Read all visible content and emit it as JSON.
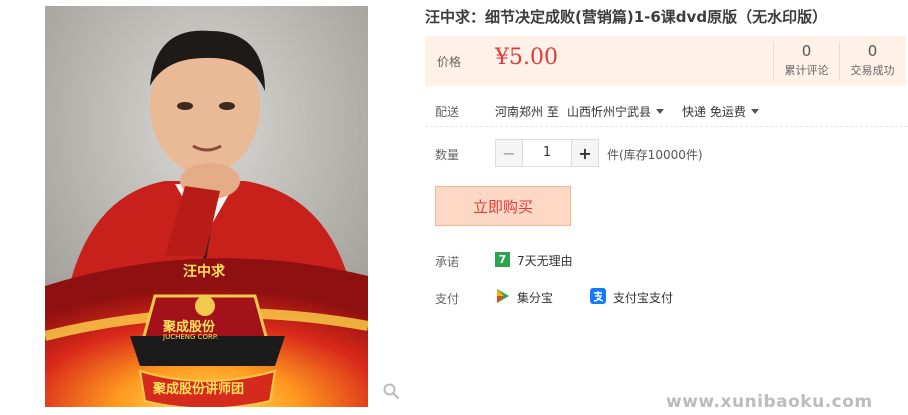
{
  "product": {
    "title": "汪中求：细节决定成败(营销篇)1-6课dvd原版（无水印版）",
    "image": {
      "person_caption": "汪中求",
      "logo_text": "聚成股份",
      "logo_subtext": "JUCHENG CORP.",
      "ribbon_text": "聚成股份讲师团"
    }
  },
  "price": {
    "label": "价格",
    "value": "¥5.00",
    "stats": [
      {
        "num": "0",
        "label": "累计评论"
      },
      {
        "num": "0",
        "label": "交易成功"
      }
    ]
  },
  "shipping": {
    "label": "配送",
    "from": "河南郑州 至",
    "to": "山西忻州宁武县",
    "method": "快递 免运费"
  },
  "quantity": {
    "label": "数量",
    "minus": "−",
    "value": "1",
    "plus": "+",
    "stock": "件(库存10000件)"
  },
  "buy_button": "立即购买",
  "promise": {
    "label": "承诺",
    "icon_text": "7",
    "text": "7天无理由"
  },
  "payment": {
    "label": "支付",
    "methods": [
      {
        "icon": "jifenbao-icon",
        "label": "集分宝"
      },
      {
        "icon": "alipay-icon",
        "label": "支付宝支付"
      }
    ]
  },
  "watermark": "www.xunibaoku.com",
  "colors": {
    "accent": "#e4393c",
    "price_bg": "#fdf1e8",
    "buy_bg": "#fdd9c5",
    "promise_green": "#2aa44f"
  }
}
